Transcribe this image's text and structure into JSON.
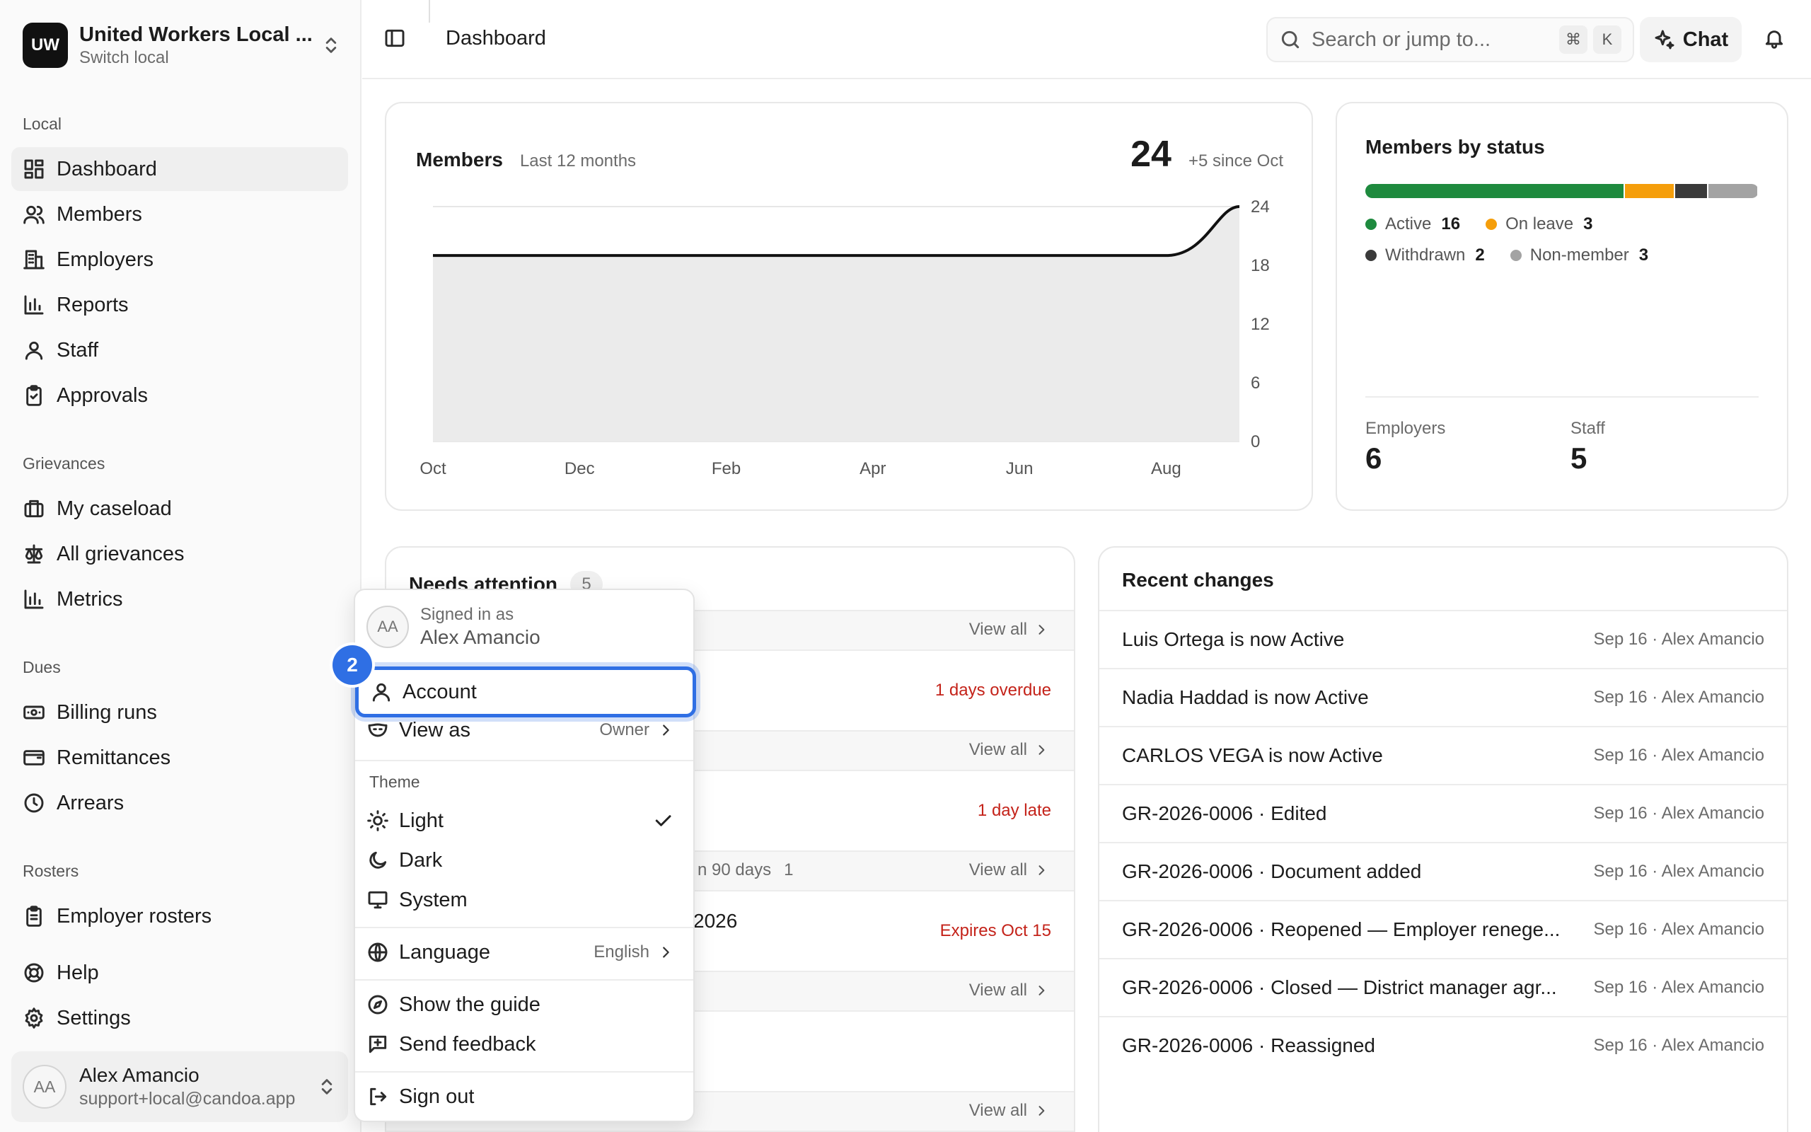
{
  "org": {
    "logo": "UW",
    "name": "United Workers Local ...",
    "switch_label": "Switch local"
  },
  "sidebar": {
    "sections": {
      "local": "Local",
      "grievances": "Grievances",
      "dues": "Dues",
      "rosters": "Rosters"
    },
    "items": [
      {
        "label": "Dashboard",
        "icon": "dashboard-icon"
      },
      {
        "label": "Members",
        "icon": "users-icon"
      },
      {
        "label": "Employers",
        "icon": "building-icon"
      },
      {
        "label": "Reports",
        "icon": "bar-chart-icon"
      },
      {
        "label": "Staff",
        "icon": "person-icon"
      },
      {
        "label": "Approvals",
        "icon": "clipboard-check-icon"
      },
      {
        "label": "My caseload",
        "icon": "briefcase-icon"
      },
      {
        "label": "All grievances",
        "icon": "scale-icon"
      },
      {
        "label": "Metrics",
        "icon": "bar-chart-icon"
      },
      {
        "label": "Billing runs",
        "icon": "banknote-icon"
      },
      {
        "label": "Remittances",
        "icon": "wallet-icon"
      },
      {
        "label": "Arrears",
        "icon": "clock-icon"
      },
      {
        "label": "Employer rosters",
        "icon": "clipboard-list-icon"
      },
      {
        "label": "Help",
        "icon": "lifebuoy-icon"
      },
      {
        "label": "Settings",
        "icon": "gear-icon"
      }
    ],
    "user": {
      "initials": "AA",
      "name": "Alex Amancio",
      "email": "support+local@candoa.app"
    }
  },
  "topbar": {
    "title": "Dashboard",
    "search_placeholder": "Search or jump to...",
    "kbd_cmd": "⌘",
    "kbd_k": "K",
    "chat_label": "Chat"
  },
  "members_card": {
    "title": "Members",
    "subtitle": "Last 12 months",
    "total": "24",
    "delta": "+5 since Oct"
  },
  "chart_data": {
    "type": "area",
    "title": "Members",
    "subtitle": "Last 12 months",
    "x": [
      "Oct",
      "Nov",
      "Dec",
      "Jan",
      "Feb",
      "Mar",
      "Apr",
      "May",
      "Jun",
      "Jul",
      "Aug",
      "Sep"
    ],
    "x_tick_labels": [
      "Oct",
      "Dec",
      "Feb",
      "Apr",
      "Jun",
      "Aug"
    ],
    "values": [
      19,
      19,
      19,
      19,
      19,
      19,
      19,
      19,
      19,
      19,
      19,
      24
    ],
    "ylim": [
      0,
      24
    ],
    "y_ticks": [
      0,
      6,
      12,
      18,
      24
    ],
    "grid": true,
    "line_color": "#111111",
    "fill_color": "#ebebeb"
  },
  "status_card": {
    "title": "Members by status",
    "segments": [
      {
        "label": "Active",
        "count": 16,
        "color": "#1e8a3e"
      },
      {
        "label": "On leave",
        "count": 3,
        "color": "#f59e0b"
      },
      {
        "label": "Withdrawn",
        "count": 2,
        "color": "#3a3a3a"
      },
      {
        "label": "Non-member",
        "count": 3,
        "color": "#a3a3a3"
      }
    ],
    "employers_label": "Employers",
    "employers_value": "6",
    "staff_label": "Staff",
    "staff_value": "5"
  },
  "attention": {
    "title": "Needs attention",
    "count": "5",
    "view_all": "View all",
    "due_1": "1 days overdue",
    "due_2": "1 day late",
    "sub3_label": "n 90 days",
    "sub3_count": "1",
    "row3_text": "2026",
    "due_3": "Expires Oct 15"
  },
  "recent": {
    "title": "Recent changes",
    "rows": [
      {
        "text": "Luis Ortega is now Active",
        "meta": "Sep 16 · Alex Amancio"
      },
      {
        "text": "Nadia Haddad is now Active",
        "meta": "Sep 16 · Alex Amancio"
      },
      {
        "text": "CARLOS VEGA is now Active",
        "meta": "Sep 16 · Alex Amancio"
      },
      {
        "text": "GR-2026-0006 · Edited",
        "meta": "Sep 16 · Alex Amancio"
      },
      {
        "text": "GR-2026-0006 · Document added",
        "meta": "Sep 16 · Alex Amancio"
      },
      {
        "text": "GR-2026-0006 · Reopened — Employer renege...",
        "meta": "Sep 16 · Alex Amancio"
      },
      {
        "text": "GR-2026-0006 · Closed — District manager agr...",
        "meta": "Sep 16 · Alex Amancio"
      },
      {
        "text": "GR-2026-0006 · Reassigned",
        "meta": "Sep 16 · Alex Amancio"
      }
    ]
  },
  "menu": {
    "signed_in_label": "Signed in as",
    "name": "Alex Amancio",
    "initials": "AA",
    "account": "Account",
    "view_as": "View as",
    "view_as_value": "Owner",
    "theme_label": "Theme",
    "light": "Light",
    "dark": "Dark",
    "system": "System",
    "language": "Language",
    "language_value": "English",
    "show_guide": "Show the guide",
    "send_feedback": "Send feedback",
    "sign_out": "Sign out"
  },
  "step_badge": "2"
}
